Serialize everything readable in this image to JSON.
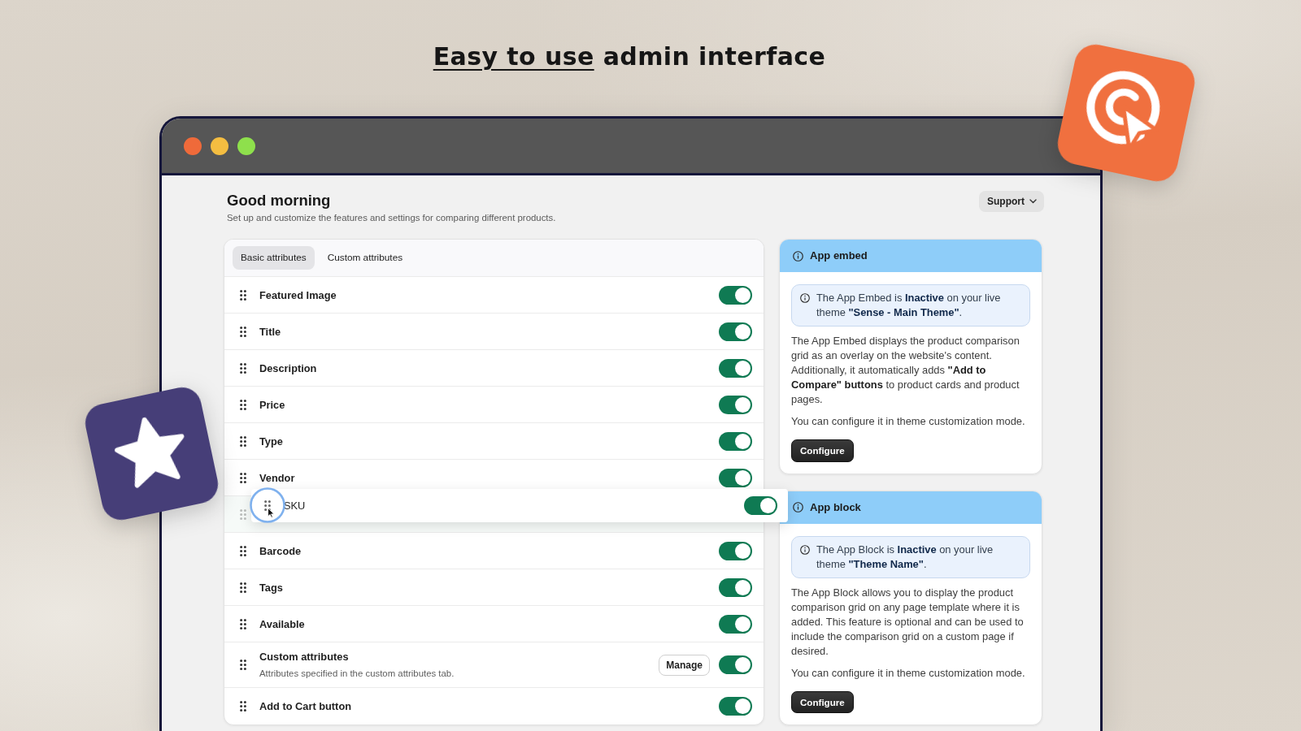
{
  "headline": {
    "underlined": "Easy to use",
    "text": "admin interface"
  },
  "window": {
    "traffic_lights": [
      {
        "color": "#ef6a3a"
      },
      {
        "color": "#f4bd41"
      },
      {
        "color": "#8ee04c"
      }
    ]
  },
  "page": {
    "title": "Good morning",
    "subtitle": "Set up and customize the features and settings for comparing different products.",
    "support_button": "Support"
  },
  "tabs": [
    {
      "label": "Basic attributes",
      "selected": true
    },
    {
      "label": "Custom attributes",
      "selected": false
    }
  ],
  "attributes": [
    {
      "kind": "row",
      "label": "Featured Image",
      "on": true
    },
    {
      "kind": "row",
      "label": "Title",
      "on": true
    },
    {
      "kind": "row",
      "label": "Description",
      "on": true
    },
    {
      "kind": "row",
      "label": "Price",
      "on": true
    },
    {
      "kind": "row",
      "label": "Type",
      "on": true
    },
    {
      "kind": "row",
      "label": "Vendor",
      "on": true
    },
    {
      "kind": "drop_placeholder"
    },
    {
      "kind": "row",
      "label": "Barcode",
      "on": true
    },
    {
      "kind": "row",
      "label": "Tags",
      "on": true
    },
    {
      "kind": "row",
      "label": "Available",
      "on": true
    },
    {
      "kind": "row_with_action",
      "label": "Custom attributes",
      "description": "Attributes specified in the custom attributes tab.",
      "action": "Manage",
      "on": true
    },
    {
      "kind": "row",
      "label": "Add to Cart button",
      "on": true
    }
  ],
  "dragged_attribute": {
    "label": "SKU",
    "on": true
  },
  "panels": [
    {
      "title": "App embed",
      "notice": "The App Embed is **Inactive** on your live theme **\"Sense - Main Theme\"**.",
      "paragraphs": [
        "The App Embed displays the product comparison grid as an overlay on the website's content. Additionally, it automatically adds **\"Add to Compare\" buttons** to product cards and product pages.",
        "You can configure it in theme customization mode."
      ],
      "button": "Configure"
    },
    {
      "title": "App block",
      "notice": "The App Block is **Inactive** on your live theme **\"Theme Name\"**.",
      "paragraphs": [
        "The App Block allows you to display the product comparison grid on any page template where it is added. This feature is optional and can be used to include the comparison grid on a custom page if desired.",
        "You can configure it in theme customization mode."
      ],
      "button": "Configure"
    }
  ]
}
